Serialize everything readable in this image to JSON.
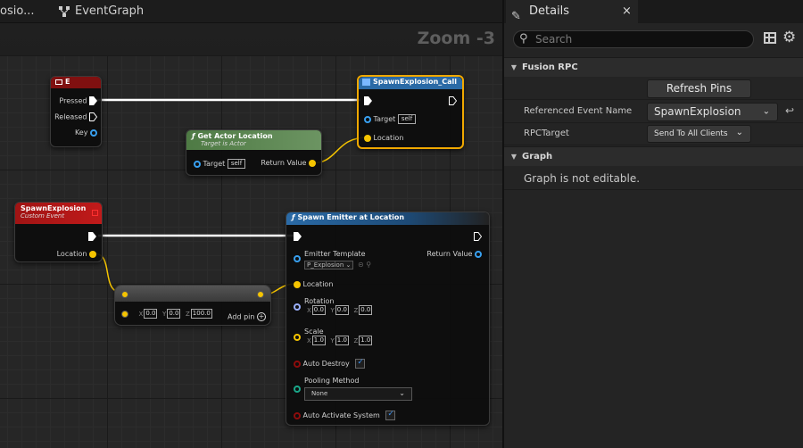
{
  "tabs": {
    "prev_tab_label": "osio...",
    "event_graph_label": "EventGraph"
  },
  "graph": {
    "zoom_label": "Zoom -3",
    "nodes": {
      "e_key": {
        "title": "E",
        "pins": {
          "pressed": "Pressed",
          "released": "Released",
          "key": "Key"
        }
      },
      "spawn_call": {
        "title": "SpawnExplosion_Call",
        "pins": {
          "target": "Target",
          "target_value": "self",
          "location": "Location"
        }
      },
      "get_actor_location": {
        "title": "Get Actor Location",
        "subtitle": "Target is Actor",
        "pins": {
          "target": "Target",
          "target_value": "self",
          "return_value": "Return Value"
        }
      },
      "spawn_event": {
        "title": "SpawnExplosion",
        "subtitle": "Custom Event",
        "pins": {
          "location": "Location"
        }
      },
      "make_array": {
        "x_label": "X",
        "x_value": "0.0",
        "y_label": "Y",
        "y_value": "0.0",
        "z_label": "Z",
        "z_value": "100.0",
        "add_pin": "Add pin"
      },
      "spawn_emitter": {
        "title": "Spawn Emitter at Location",
        "pins": {
          "emitter_template": "Emitter Template",
          "emitter_value": "P_Explosion",
          "return_value": "Return Value",
          "location": "Location",
          "rotation": "Rotation",
          "rotation_x": "0.0",
          "rotation_y": "0.0",
          "rotation_z": "0.0",
          "scale": "Scale",
          "scale_x": "1.0",
          "scale_y": "1.0",
          "scale_z": "1.0",
          "auto_destroy": "Auto Destroy",
          "pooling_method": "Pooling Method",
          "pooling_value": "None",
          "auto_activate": "Auto Activate System",
          "x": "X",
          "y": "Y",
          "z": "Z"
        }
      }
    }
  },
  "details": {
    "tab_label": "Details",
    "close_glyph": "×",
    "search_placeholder": "Search",
    "categories": {
      "fusion_rpc": "Fusion RPC",
      "graph": "Graph"
    },
    "refresh_pins_label": "Refresh Pins",
    "referenced_event_label": "Referenced Event Name",
    "referenced_event_value": "SpawnExplosion",
    "rpc_target_label": "RPCTarget",
    "rpc_target_value": "Send To All Clients",
    "graph_not_editable": "Graph is not editable."
  },
  "colors": {
    "exec": "#ffffff",
    "object_pin": "#38a0f0",
    "vector_pin": "#f5c400",
    "rotator_pin": "#9bb0ff",
    "bool_pin": "#8e0c0c",
    "event_header": "#a01414",
    "function_header": "#2a6aa6",
    "pure_header": "#5a8a4a",
    "selected_outline": "#f0a800"
  }
}
